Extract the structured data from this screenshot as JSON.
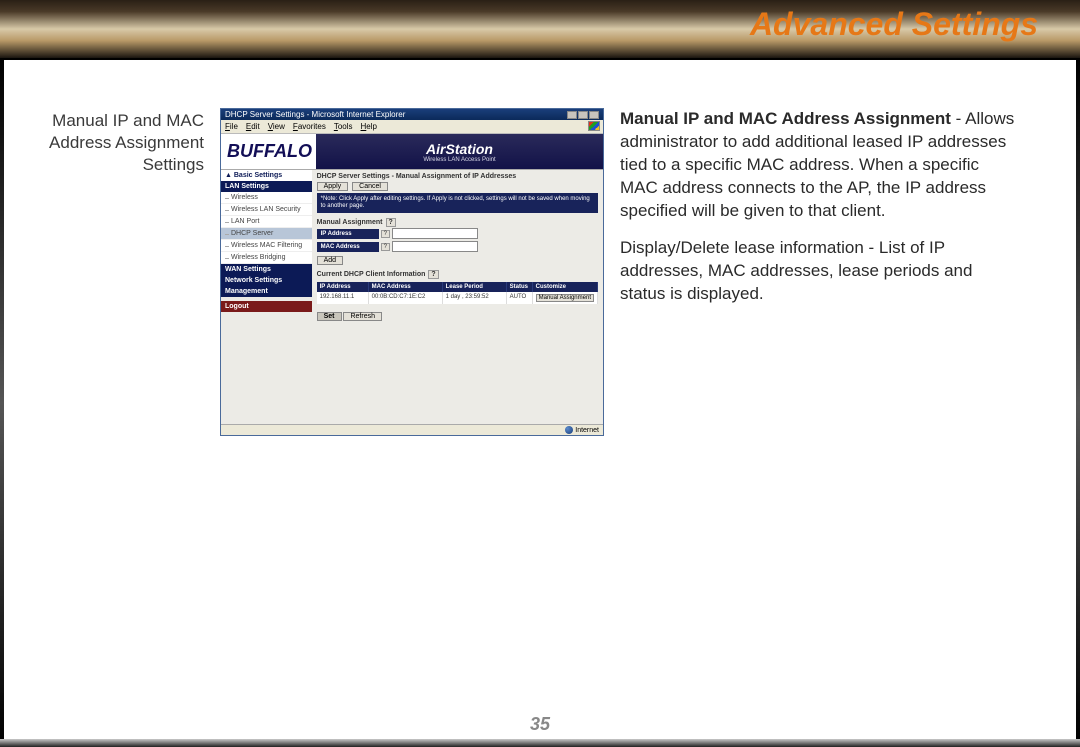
{
  "page": {
    "title": "Advanced Settings",
    "number": "35"
  },
  "left_label": "Manual IP and MAC Address Assignment Settings",
  "ie": {
    "title": "DHCP Server Settings - Microsoft Internet Explorer",
    "menus": [
      "File",
      "Edit",
      "View",
      "Favorites",
      "Tools",
      "Help"
    ],
    "status": "Internet"
  },
  "branding": {
    "logo": "BUFFALO",
    "product": "AirStation",
    "subtitle": "Wireless LAN Access Point"
  },
  "sidebar": {
    "basic": "▲ Basic Settings",
    "lan_head": "LAN Settings",
    "items": [
      "Wireless",
      "Wireless LAN Security",
      "LAN Port",
      "DHCP Server",
      "Wireless MAC Filtering",
      "Wireless Bridging"
    ],
    "wan_head": "WAN Settings",
    "net_head": "Network Settings",
    "mgmt_head": "Management",
    "logout": "Logout"
  },
  "panel": {
    "heading": "DHCP Server Settings - Manual Assignment of IP Addresses",
    "apply": "Apply",
    "cancel": "Cancel",
    "note": "*Note: Click Apply after editing settings. If Apply is not clicked, settings will not be saved when moving to another page.",
    "manual_head": "Manual Assignment",
    "ip_label": "IP Address",
    "mac_label": "MAC Address",
    "add": "Add",
    "current_head": "Current DHCP Client Information",
    "cols": {
      "ip": "IP Address",
      "mac": "MAC Address",
      "lease": "Lease Period",
      "status": "Status",
      "customize": "Customize"
    },
    "row": {
      "ip": "192.168.11.1",
      "mac": "00:0B:CD:C7:1E:C2",
      "lease": "1 day , 23:59:52",
      "status": "AUTO",
      "btn": "Manual Assignment"
    },
    "set": "Set",
    "refresh": "Refresh"
  },
  "description": {
    "para1_bold": "Manual IP and MAC Address Assignment",
    "para1_rest": " - Allows administra­tor to add additional leased IP addresses tied to a specific MAC address.  When a specific MAC address connects to the AP, the IP address specified will be given to that client.",
    "para2": "Display/Delete lease informa­tion - List of IP addresses, MAC addresses, lease periods and status is displayed."
  }
}
